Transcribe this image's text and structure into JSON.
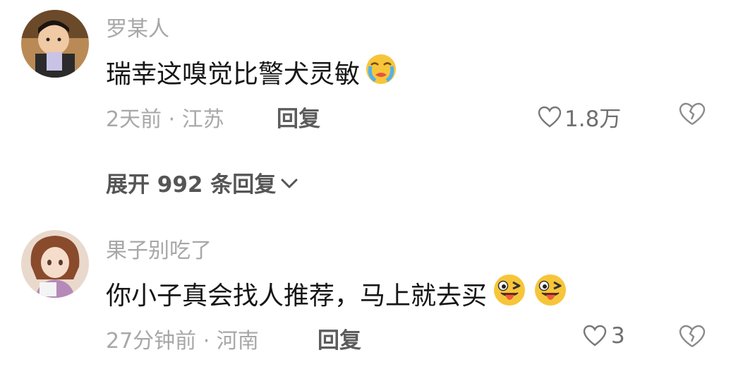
{
  "comments": [
    {
      "username": "罗某人",
      "text": "瑞幸这嗅觉比警犬灵敏",
      "emoji_icons": [
        "crying-face-emoji-icon"
      ],
      "time_location": "2天前 · 江苏",
      "reply_label": "回复",
      "likes": "1.8万",
      "expand_replies": "展开 992 条回复"
    },
    {
      "username": "果子别吃了",
      "text": "你小子真会找人推荐，马上就去买",
      "emoji_icons": [
        "winking-tongue-emoji-icon",
        "winking-tongue-emoji-icon"
      ],
      "time_location": "27分钟前 · 河南",
      "reply_label": "回复",
      "likes": "3"
    }
  ],
  "icons": {
    "like": "heart-outline-icon",
    "dislike": "broken-heart-icon",
    "expand": "chevron-down-icon"
  },
  "colors": {
    "username": "#a7a7a7",
    "body_text": "#161616",
    "meta": "#a8a8a8",
    "reply": "#5c5c5c"
  }
}
